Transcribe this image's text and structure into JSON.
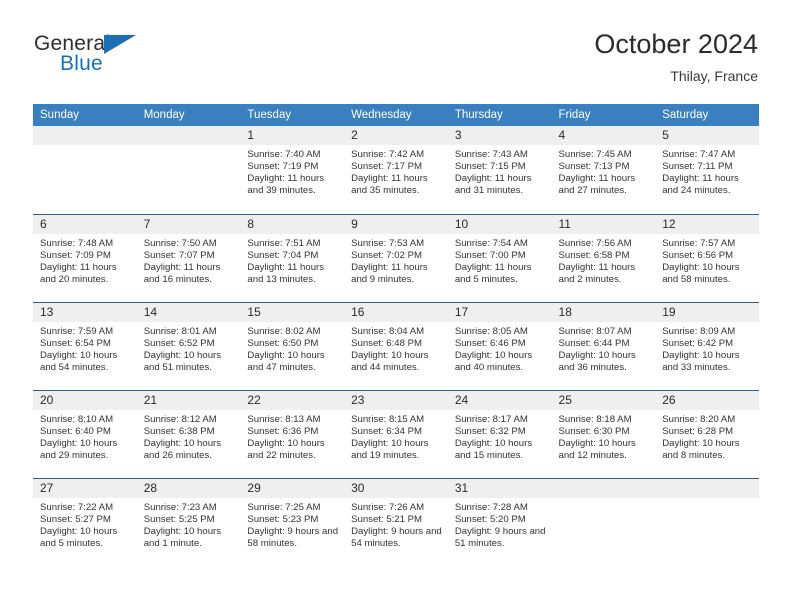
{
  "brand": {
    "name_part1": "General",
    "name_part2": "Blue",
    "accent_color": "#1573bd",
    "triangle_color": "#1b6fb5",
    "logo_icon": "blue-triangle-icon"
  },
  "header": {
    "title": "October 2024",
    "subtitle": "Thilay, France"
  },
  "calendar": {
    "header_bg": "#3a7fc0",
    "header_text_color": "#ffffff",
    "daynum_bg": "#efefef",
    "row_divider_color": "#2a6096",
    "columns": [
      "Sunday",
      "Monday",
      "Tuesday",
      "Wednesday",
      "Thursday",
      "Friday",
      "Saturday"
    ],
    "weeks": [
      [
        {
          "day": "",
          "sunrise": "",
          "sunset": "",
          "daylight": ""
        },
        {
          "day": "",
          "sunrise": "",
          "sunset": "",
          "daylight": ""
        },
        {
          "day": "1",
          "sunrise": "Sunrise: 7:40 AM",
          "sunset": "Sunset: 7:19 PM",
          "daylight": "Daylight: 11 hours and 39 minutes."
        },
        {
          "day": "2",
          "sunrise": "Sunrise: 7:42 AM",
          "sunset": "Sunset: 7:17 PM",
          "daylight": "Daylight: 11 hours and 35 minutes."
        },
        {
          "day": "3",
          "sunrise": "Sunrise: 7:43 AM",
          "sunset": "Sunset: 7:15 PM",
          "daylight": "Daylight: 11 hours and 31 minutes."
        },
        {
          "day": "4",
          "sunrise": "Sunrise: 7:45 AM",
          "sunset": "Sunset: 7:13 PM",
          "daylight": "Daylight: 11 hours and 27 minutes."
        },
        {
          "day": "5",
          "sunrise": "Sunrise: 7:47 AM",
          "sunset": "Sunset: 7:11 PM",
          "daylight": "Daylight: 11 hours and 24 minutes."
        }
      ],
      [
        {
          "day": "6",
          "sunrise": "Sunrise: 7:48 AM",
          "sunset": "Sunset: 7:09 PM",
          "daylight": "Daylight: 11 hours and 20 minutes."
        },
        {
          "day": "7",
          "sunrise": "Sunrise: 7:50 AM",
          "sunset": "Sunset: 7:07 PM",
          "daylight": "Daylight: 11 hours and 16 minutes."
        },
        {
          "day": "8",
          "sunrise": "Sunrise: 7:51 AM",
          "sunset": "Sunset: 7:04 PM",
          "daylight": "Daylight: 11 hours and 13 minutes."
        },
        {
          "day": "9",
          "sunrise": "Sunrise: 7:53 AM",
          "sunset": "Sunset: 7:02 PM",
          "daylight": "Daylight: 11 hours and 9 minutes."
        },
        {
          "day": "10",
          "sunrise": "Sunrise: 7:54 AM",
          "sunset": "Sunset: 7:00 PM",
          "daylight": "Daylight: 11 hours and 5 minutes."
        },
        {
          "day": "11",
          "sunrise": "Sunrise: 7:56 AM",
          "sunset": "Sunset: 6:58 PM",
          "daylight": "Daylight: 11 hours and 2 minutes."
        },
        {
          "day": "12",
          "sunrise": "Sunrise: 7:57 AM",
          "sunset": "Sunset: 6:56 PM",
          "daylight": "Daylight: 10 hours and 58 minutes."
        }
      ],
      [
        {
          "day": "13",
          "sunrise": "Sunrise: 7:59 AM",
          "sunset": "Sunset: 6:54 PM",
          "daylight": "Daylight: 10 hours and 54 minutes."
        },
        {
          "day": "14",
          "sunrise": "Sunrise: 8:01 AM",
          "sunset": "Sunset: 6:52 PM",
          "daylight": "Daylight: 10 hours and 51 minutes."
        },
        {
          "day": "15",
          "sunrise": "Sunrise: 8:02 AM",
          "sunset": "Sunset: 6:50 PM",
          "daylight": "Daylight: 10 hours and 47 minutes."
        },
        {
          "day": "16",
          "sunrise": "Sunrise: 8:04 AM",
          "sunset": "Sunset: 6:48 PM",
          "daylight": "Daylight: 10 hours and 44 minutes."
        },
        {
          "day": "17",
          "sunrise": "Sunrise: 8:05 AM",
          "sunset": "Sunset: 6:46 PM",
          "daylight": "Daylight: 10 hours and 40 minutes."
        },
        {
          "day": "18",
          "sunrise": "Sunrise: 8:07 AM",
          "sunset": "Sunset: 6:44 PM",
          "daylight": "Daylight: 10 hours and 36 minutes."
        },
        {
          "day": "19",
          "sunrise": "Sunrise: 8:09 AM",
          "sunset": "Sunset: 6:42 PM",
          "daylight": "Daylight: 10 hours and 33 minutes."
        }
      ],
      [
        {
          "day": "20",
          "sunrise": "Sunrise: 8:10 AM",
          "sunset": "Sunset: 6:40 PM",
          "daylight": "Daylight: 10 hours and 29 minutes."
        },
        {
          "day": "21",
          "sunrise": "Sunrise: 8:12 AM",
          "sunset": "Sunset: 6:38 PM",
          "daylight": "Daylight: 10 hours and 26 minutes."
        },
        {
          "day": "22",
          "sunrise": "Sunrise: 8:13 AM",
          "sunset": "Sunset: 6:36 PM",
          "daylight": "Daylight: 10 hours and 22 minutes."
        },
        {
          "day": "23",
          "sunrise": "Sunrise: 8:15 AM",
          "sunset": "Sunset: 6:34 PM",
          "daylight": "Daylight: 10 hours and 19 minutes."
        },
        {
          "day": "24",
          "sunrise": "Sunrise: 8:17 AM",
          "sunset": "Sunset: 6:32 PM",
          "daylight": "Daylight: 10 hours and 15 minutes."
        },
        {
          "day": "25",
          "sunrise": "Sunrise: 8:18 AM",
          "sunset": "Sunset: 6:30 PM",
          "daylight": "Daylight: 10 hours and 12 minutes."
        },
        {
          "day": "26",
          "sunrise": "Sunrise: 8:20 AM",
          "sunset": "Sunset: 6:28 PM",
          "daylight": "Daylight: 10 hours and 8 minutes."
        }
      ],
      [
        {
          "day": "27",
          "sunrise": "Sunrise: 7:22 AM",
          "sunset": "Sunset: 5:27 PM",
          "daylight": "Daylight: 10 hours and 5 minutes."
        },
        {
          "day": "28",
          "sunrise": "Sunrise: 7:23 AM",
          "sunset": "Sunset: 5:25 PM",
          "daylight": "Daylight: 10 hours and 1 minute."
        },
        {
          "day": "29",
          "sunrise": "Sunrise: 7:25 AM",
          "sunset": "Sunset: 5:23 PM",
          "daylight": "Daylight: 9 hours and 58 minutes."
        },
        {
          "day": "30",
          "sunrise": "Sunrise: 7:26 AM",
          "sunset": "Sunset: 5:21 PM",
          "daylight": "Daylight: 9 hours and 54 minutes."
        },
        {
          "day": "31",
          "sunrise": "Sunrise: 7:28 AM",
          "sunset": "Sunset: 5:20 PM",
          "daylight": "Daylight: 9 hours and 51 minutes."
        },
        {
          "day": "",
          "sunrise": "",
          "sunset": "",
          "daylight": ""
        },
        {
          "day": "",
          "sunrise": "",
          "sunset": "",
          "daylight": ""
        }
      ]
    ]
  }
}
